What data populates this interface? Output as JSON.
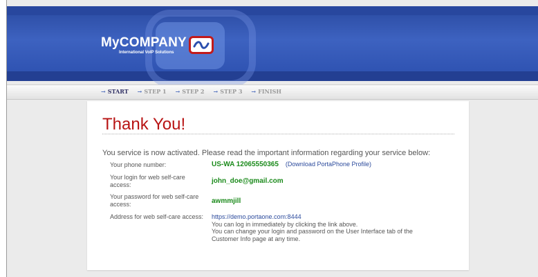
{
  "header": {
    "logo": {
      "brand": "MyCOMPANY",
      "tagline": "International VoIP Solutions",
      "icon": "wave-icon"
    }
  },
  "nav": {
    "steps": [
      {
        "label": "START",
        "active": true
      },
      {
        "label": "STEP 1",
        "active": false
      },
      {
        "label": "STEP 2",
        "active": false
      },
      {
        "label": "STEP 3",
        "active": false
      },
      {
        "label": "FINISH",
        "active": false
      }
    ],
    "arrow_icon": "arrow-right-icon"
  },
  "content": {
    "title": "Thank You!",
    "intro": "You service is now activated. Please read the important information regarding your service below:",
    "phone": {
      "label": "Your phone number:",
      "value": "US-WA 12065550365",
      "link": "(Download PortaPhone Profile)"
    },
    "login": {
      "label": "Your login for web self-care access:",
      "value": "john_doe@gmail.com"
    },
    "password": {
      "label": "Your password for web self-care access:",
      "value": "awmmjill"
    },
    "address": {
      "label": "Address for web self-care access:",
      "url": "https://demo.portaone.com:8444",
      "note1": "You can log in immediately by clicking the link above.",
      "note2": "You can change your login and password on the User Interface tab of the Customer Info page at any time."
    }
  },
  "colors": {
    "header_blue": "#2b4fae",
    "title_red": "#b81414",
    "value_green": "#1b8a1b",
    "link_blue": "#2b4a9c"
  }
}
